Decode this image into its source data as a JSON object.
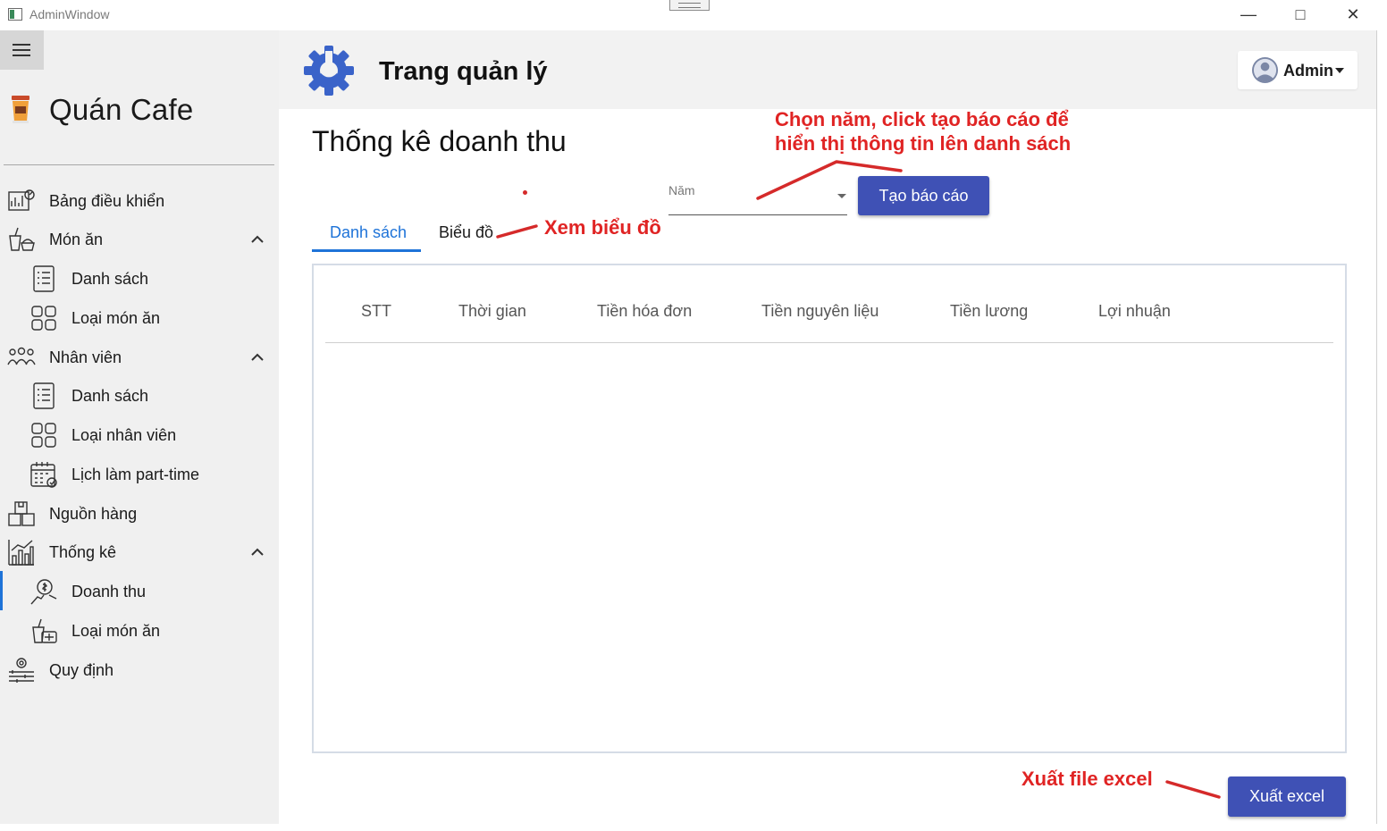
{
  "window": {
    "title": "AdminWindow"
  },
  "sidebar": {
    "brand": "Quán Cafe",
    "items": [
      {
        "label": "Bảng điều khiển",
        "icon": "dashboard-icon"
      },
      {
        "label": "Món ăn",
        "icon": "food-icon",
        "expanded": true
      },
      {
        "label": "Danh sách",
        "icon": "list-icon"
      },
      {
        "label": "Loại món ăn",
        "icon": "categories-icon"
      },
      {
        "label": "Nhân viên",
        "icon": "employees-icon",
        "expanded": true
      },
      {
        "label": "Danh sách",
        "icon": "list-icon"
      },
      {
        "label": "Loại nhân viên",
        "icon": "categories-icon"
      },
      {
        "label": "Lịch làm part-time",
        "icon": "calendar-icon"
      },
      {
        "label": "Nguồn hàng",
        "icon": "boxes-icon"
      },
      {
        "label": "Thống kê",
        "icon": "statistics-icon",
        "expanded": true
      },
      {
        "label": "Doanh thu",
        "icon": "revenue-icon",
        "active": true
      },
      {
        "label": "Loại món ăn",
        "icon": "food-type-icon"
      },
      {
        "label": "Quy định",
        "icon": "rules-icon"
      }
    ]
  },
  "header": {
    "title": "Trang quản lý",
    "user_label": "Admin"
  },
  "main": {
    "page_title": "Thống kê doanh thu",
    "year_field": {
      "label": "Năm",
      "value": ""
    },
    "report_button": "Tạo báo cáo",
    "tabs": [
      {
        "label": "Danh sách",
        "active": true
      },
      {
        "label": "Biểu đồ",
        "active": false
      }
    ],
    "table": {
      "columns": [
        "STT",
        "Thời gian",
        "Tiền hóa đơn",
        "Tiền nguyên liệu",
        "Tiền lương",
        "Lợi nhuận"
      ],
      "rows": []
    },
    "export_button": "Xuất excel"
  },
  "annotations": {
    "select_year_line1": "Chọn năm, click tạo báo cáo để",
    "select_year_line2": "hiển thị thông tin lên danh sách",
    "view_chart": "Xem biểu đồ",
    "export": "Xuất file excel"
  },
  "colors": {
    "accent": "#3f51b5",
    "tab_active": "#1e73d8",
    "annotation": "#e02424",
    "sidebar_bg": "#f0f0f0",
    "header_bg": "#f2f2f2"
  }
}
